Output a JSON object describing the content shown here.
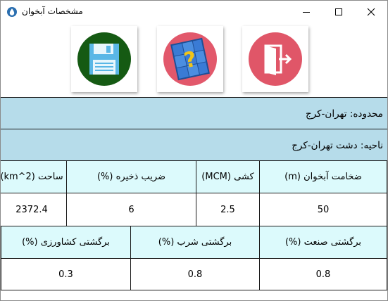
{
  "window": {
    "title": "مشخصات آبخوان"
  },
  "toolbar": {
    "save_icon": "floppy-disk-icon",
    "help_icon": "help-question-icon",
    "exit_icon": "exit-door-icon",
    "colors": {
      "save_bg": "#155a13",
      "help_bg": "#e2586b",
      "exit_bg": "#e05668"
    }
  },
  "info": {
    "region": "محدوده: تهران-کرج",
    "area": "ناحیه: دشت تهران-کرج"
  },
  "table1": {
    "headers": [
      "ضخامت آبخوان (m)",
      "کشی (MCM)",
      "ضریب ذخیره (%)",
      "ساحت (km^2)"
    ],
    "values": [
      "50",
      "2.5",
      "6",
      "2372.4"
    ]
  },
  "table2": {
    "headers": [
      "برگشتی صنعت (%)",
      "برگشتی شرب (%)",
      "برگشتی کشاورزی (%)"
    ],
    "values": [
      "0.8",
      "0.8",
      "0.3"
    ]
  },
  "colors": {
    "info_bg": "#b6dcea",
    "header_bg": "#dcfafc"
  }
}
